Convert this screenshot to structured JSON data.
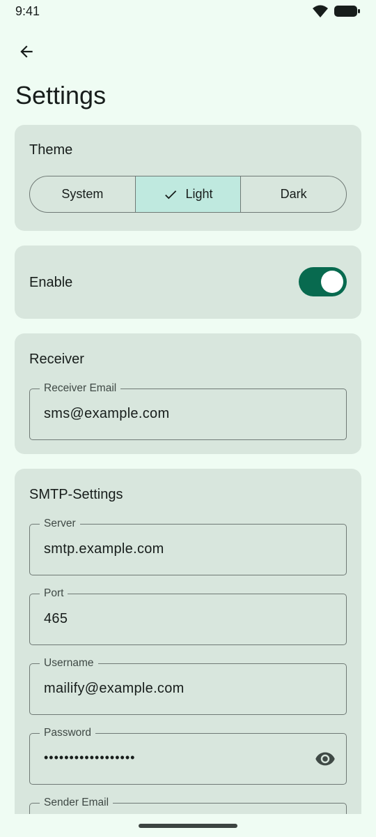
{
  "status_bar": {
    "time": "9:41"
  },
  "page": {
    "title": "Settings"
  },
  "theme": {
    "title": "Theme",
    "options": [
      "System",
      "Light",
      "Dark"
    ],
    "selected": "Light"
  },
  "enable": {
    "label": "Enable",
    "on": true
  },
  "receiver": {
    "title": "Receiver",
    "email_label": "Receiver Email",
    "email_value": "sms@example.com"
  },
  "smtp": {
    "title": "SMTP-Settings",
    "server_label": "Server",
    "server_value": "smtp.example.com",
    "port_label": "Port",
    "port_value": "465",
    "username_label": "Username",
    "username_value": "mailify@example.com",
    "password_label": "Password",
    "password_value": "••••••••••••••••••",
    "sender_label": "Sender Email"
  },
  "colors": {
    "background": "#effcf3",
    "card": "#d8e6dd",
    "accent": "#086a4f",
    "selected_segment": "#bfe9df"
  }
}
